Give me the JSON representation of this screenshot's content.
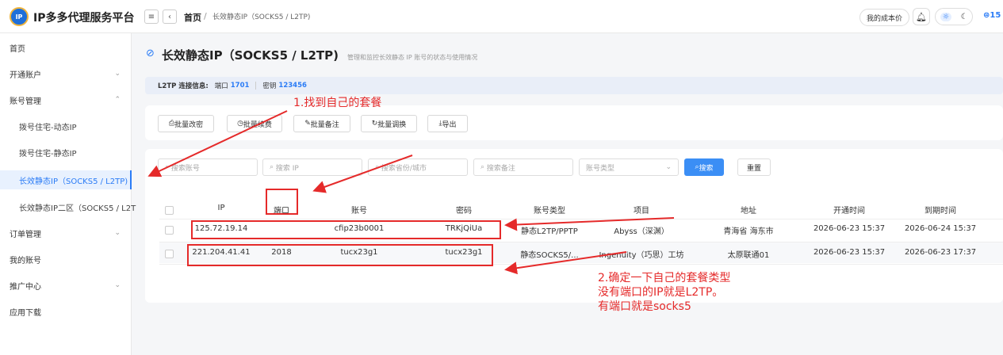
{
  "app": {
    "brand": "IP多多代理服务平台",
    "logo_text": "IP多多"
  },
  "breadcrumb": {
    "home": "首页",
    "sep": "/",
    "current": "长效静态IP（SOCKS5 / L2TP)"
  },
  "header": {
    "cost_label": "我的成本价",
    "balance": "⊜15"
  },
  "sidebar": {
    "items": [
      {
        "label": "首页",
        "sub": false,
        "chevron": ""
      },
      {
        "label": "开通账户",
        "sub": false,
        "chevron": "⌄"
      },
      {
        "label": "账号管理",
        "sub": false,
        "chevron": "⌃"
      },
      {
        "label": "拨号住宅-动态IP",
        "sub": true,
        "chevron": ""
      },
      {
        "label": "拨号住宅-静态IP",
        "sub": true,
        "chevron": ""
      },
      {
        "label": "长效静态IP（SOCKS5 / L2TP)",
        "sub": true,
        "chevron": "",
        "active": true
      },
      {
        "label": "长效静态IP二区（SOCKS5 / L2T",
        "sub": true,
        "chevron": ""
      },
      {
        "label": "订单管理",
        "sub": false,
        "chevron": "⌄"
      },
      {
        "label": "我的账号",
        "sub": false,
        "chevron": ""
      },
      {
        "label": "推广中心",
        "sub": false,
        "chevron": "⌄"
      },
      {
        "label": "应用下载",
        "sub": false,
        "chevron": ""
      }
    ]
  },
  "page": {
    "title": "长效静态IP（SOCKS5 / L2TP)",
    "subtitle": "管理和监控长效静态 IP 账号的状态与使用情况",
    "l2tp": {
      "label": "L2TP 连接信息:",
      "port_label": "端口",
      "port": "1701",
      "key_label": "密钥",
      "key": "123456"
    }
  },
  "toolbar": [
    {
      "icon": "⎙",
      "label": "批量改密"
    },
    {
      "icon": "◷",
      "label": "批量续费"
    },
    {
      "icon": "✎",
      "label": "批量备注"
    },
    {
      "icon": "↻",
      "label": "批量调换"
    },
    {
      "icon": "⤓",
      "label": "导出"
    }
  ],
  "filters": {
    "account": "搜索账号",
    "ip": "搜索 IP",
    "region": "搜索省份/城市",
    "note": "搜索备注",
    "type": "账号类型",
    "search_btn": "搜索",
    "reset_btn": "重置"
  },
  "table": {
    "headers": [
      "IP",
      "端口",
      "账号",
      "密码",
      "账号类型",
      "项目",
      "地址",
      "开通时间",
      "到期时间"
    ],
    "rows": [
      [
        "125.72.19.14",
        "",
        "cfip23b0001",
        "TRKjQiUa",
        "静态L2TP/PPTP",
        "Abyss（深渊）",
        "青海省 海东市",
        "2026-06-23 15:37",
        "2026-06-24 15:37"
      ],
      [
        "221.204.41.41",
        "2018",
        "tucx23g1",
        "tucx23g1",
        "静态SOCKS5/...",
        "Ingenuity（巧思）工坊",
        "太原联通01",
        "2026-06-23 15:37",
        "2026-06-23 17:37"
      ]
    ]
  },
  "annotations": {
    "a1": "1.找到自己的套餐",
    "a2": [
      "2.确定一下自己的套餐类型",
      "没有端口的IP就是L2TP。",
      "有端口就是socks5"
    ]
  }
}
